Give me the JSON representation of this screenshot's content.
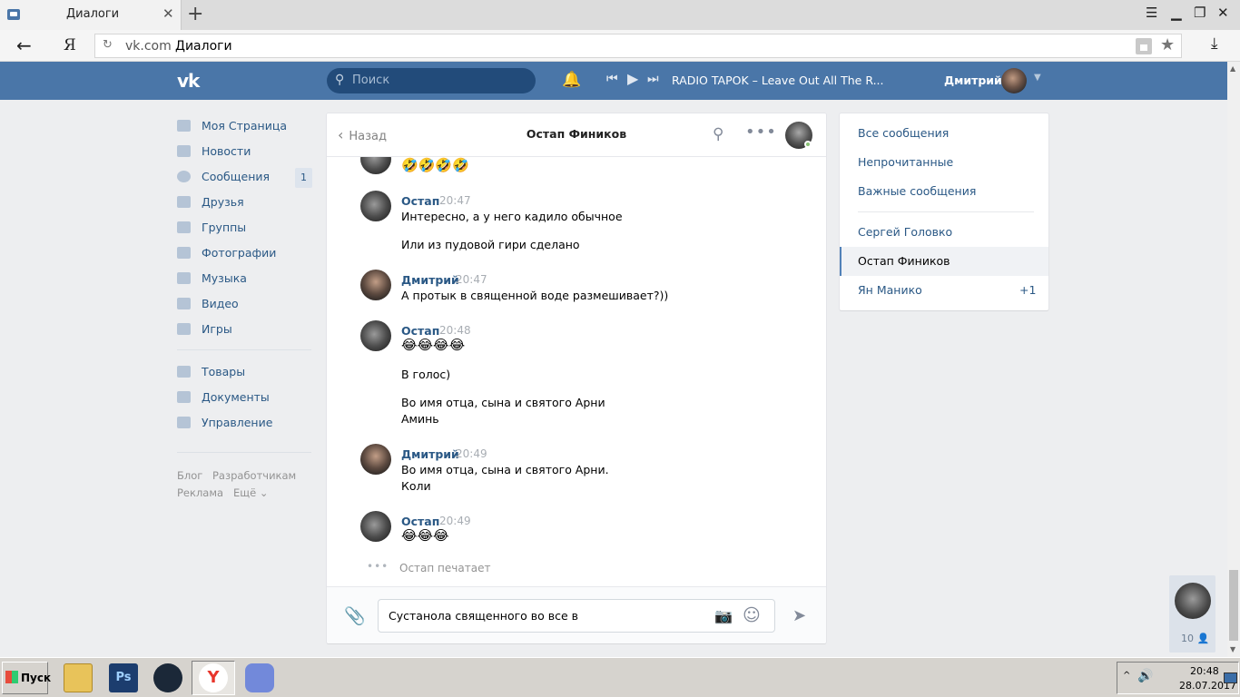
{
  "browser": {
    "tab_title": "Диалоги",
    "tab_close": "✕",
    "new_tab": "+",
    "url_domain": "vk.com",
    "url_title": "Диалоги",
    "yandex_button": "Я"
  },
  "header": {
    "logo": "vk",
    "search_placeholder": "Поиск",
    "track_title": "RADIO TAPOK – Leave Out All The R...",
    "user_name": "Дмитрий"
  },
  "sidebar": {
    "items": [
      {
        "label": "Моя Страница",
        "icon": "home-icon"
      },
      {
        "label": "Новости",
        "icon": "news-icon"
      },
      {
        "label": "Сообщения",
        "icon": "messages-icon",
        "badge": "1"
      },
      {
        "label": "Друзья",
        "icon": "friends-icon"
      },
      {
        "label": "Группы",
        "icon": "groups-icon"
      },
      {
        "label": "Фотографии",
        "icon": "camera-icon"
      },
      {
        "label": "Музыка",
        "icon": "music-icon"
      },
      {
        "label": "Видео",
        "icon": "video-icon"
      },
      {
        "label": "Игры",
        "icon": "gamepad-icon"
      },
      {
        "label": "Товары",
        "icon": "bag-icon"
      },
      {
        "label": "Документы",
        "icon": "document-icon"
      },
      {
        "label": "Управление",
        "icon": "gamepad-icon"
      }
    ],
    "footer": {
      "blog": "Блог",
      "developers": "Разработчикам",
      "ads": "Реклама",
      "more": "Ещё ⌄"
    }
  },
  "chat": {
    "back_label": "Назад",
    "title": "Остап Фиников",
    "messages": [
      {
        "emoji": "🤣🤣🤣🤣"
      },
      {
        "author": "Остап",
        "time": "20:47",
        "lines": [
          "Интересно, а у него кадило обычное",
          "Или из пудовой гири сделано"
        ]
      },
      {
        "author": "Дмитрий",
        "time": "20:47",
        "lines": [
          "А протык в священной воде размешивает?))"
        ]
      },
      {
        "author": "Остап",
        "time": "20:48",
        "emoji": "😂😂😂😂",
        "lines": [
          "В голос)",
          "Во имя отца, сына и святого Арни",
          "Аминь"
        ]
      },
      {
        "author": "Дмитрий",
        "time": "20:49",
        "lines": [
          "Во имя отца, сына и святого Арни.",
          "Коли"
        ]
      },
      {
        "author": "Остап",
        "time": "20:49",
        "emoji": "😂😂😂"
      }
    ],
    "typing": "Остап печатает",
    "input_value": "Сустанола священного во все в"
  },
  "filters": {
    "all": "Все сообщения",
    "unread": "Непрочитанные",
    "important": "Важные сообщения",
    "dialogs": [
      {
        "name": "Сергей Головко"
      },
      {
        "name": "Остап Фиников"
      },
      {
        "name": "Ян Манико",
        "count": "+1"
      }
    ]
  },
  "floating_chat": {
    "count": "10"
  },
  "taskbar": {
    "start_label": "Пуск",
    "apps": [
      "folder-icon",
      "photoshop-icon",
      "steam-icon",
      "yandex-browser-icon",
      "discord-icon"
    ],
    "ps_label": "Ps",
    "yandex_label": "Y",
    "time": "20:48",
    "date": "28.07.2017"
  },
  "colors": {
    "vk_blue": "#4a76a8",
    "link": "#2a5885",
    "background": "#edeef0"
  }
}
